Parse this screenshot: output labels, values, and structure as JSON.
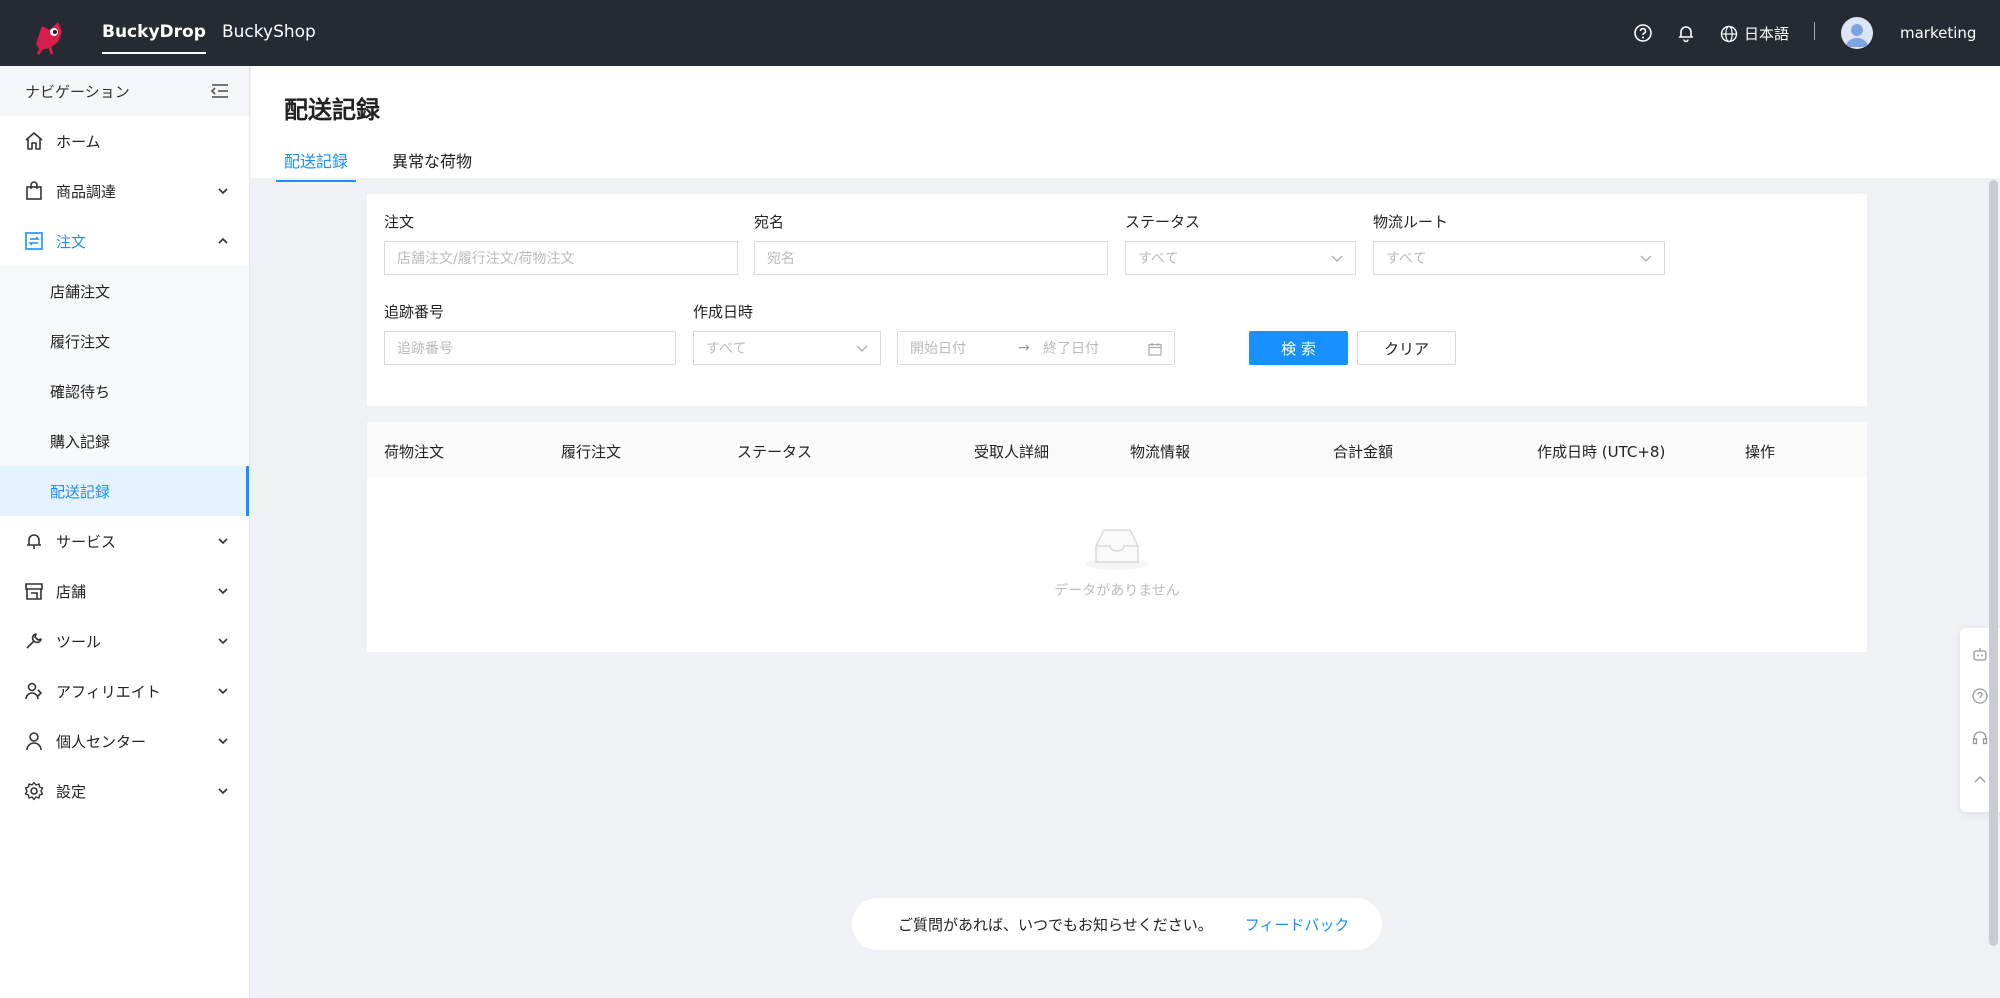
{
  "topbar": {
    "tabs": [
      {
        "label": "BuckyDrop",
        "active": true
      },
      {
        "label": "BuckyShop",
        "active": false
      }
    ],
    "language": "日本語",
    "username": "marketing",
    "icons": [
      "help-icon",
      "bell-icon",
      "globe-icon"
    ]
  },
  "sidebar": {
    "header": "ナビゲーション",
    "items": [
      {
        "label": "ホーム",
        "icon": "home-icon"
      },
      {
        "label": "商品調達",
        "icon": "bag-icon"
      },
      {
        "label": "注文",
        "icon": "order-icon",
        "open": true,
        "children": [
          "店舗注文",
          "履行注文",
          "確認待ち",
          "購入記録",
          "配送記録"
        ]
      },
      {
        "label": "サービス",
        "icon": "bell-service-icon"
      },
      {
        "label": "店舗",
        "icon": "store-icon"
      },
      {
        "label": "ツール",
        "icon": "wrench-icon"
      },
      {
        "label": "アフィリエイト",
        "icon": "affiliate-icon"
      },
      {
        "label": "個人センター",
        "icon": "user-icon"
      },
      {
        "label": "設定",
        "icon": "gear-icon"
      }
    ],
    "active_child": "配送記録"
  },
  "main": {
    "title": "配送記録",
    "tabs": [
      {
        "label": "配送記録",
        "active": true
      },
      {
        "label": "異常な荷物",
        "active": false
      }
    ]
  },
  "filters": {
    "order": {
      "label": "注文",
      "placeholder": "店舗注文/履行注文/荷物注文"
    },
    "recipient": {
      "label": "宛名",
      "placeholder": "宛名"
    },
    "status": {
      "label": "ステータス",
      "value": "すべて"
    },
    "route": {
      "label": "物流ルート",
      "value": "すべて"
    },
    "tracking": {
      "label": "追跡番号",
      "placeholder": "追跡番号"
    },
    "created": {
      "label": "作成日時",
      "value": "すべて",
      "start_placeholder": "開始日付",
      "end_placeholder": "終了日付"
    },
    "search_label": "検 索",
    "clear_label": "クリア"
  },
  "table": {
    "columns": [
      "荷物注文",
      "履行注文",
      "ステータス",
      "受取人詳細",
      "物流情報",
      "合計金額",
      "作成日時 (UTC+8)",
      "操作"
    ],
    "empty_text": "データがありません"
  },
  "feedback": {
    "text": "ご質問があれば、いつでもお知らせください。",
    "link": "フィードバック"
  },
  "colors": {
    "accent": "#1890ff",
    "topbar": "#262a33",
    "logo": "#d81e4a"
  }
}
